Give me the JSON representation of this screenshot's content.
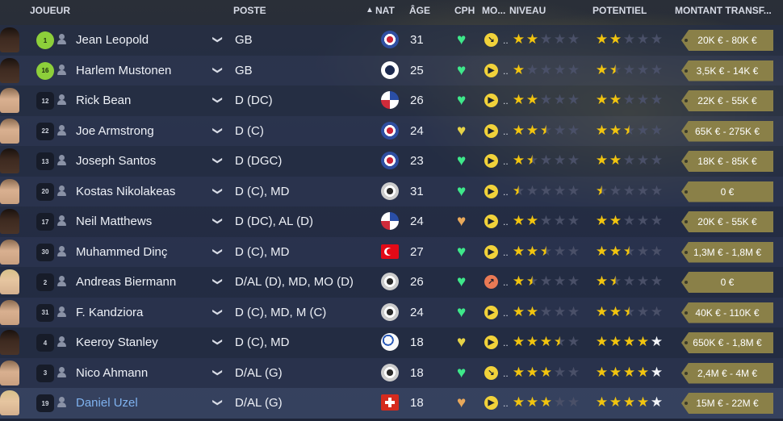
{
  "header": {
    "joueur": "JOUEUR",
    "poste": "POSTE",
    "sort_arrow": "▲",
    "nat": "NAT",
    "age": "ÂGE",
    "cph": "CPH",
    "mo": "MO...",
    "niveau": "NIVEAU",
    "potentiel": "POTENTIEL",
    "montant": "MONTANT TRANSF..."
  },
  "players": [
    {
      "shirt": "1",
      "name": "Jean Leopold",
      "poste": "GB",
      "nat": "fr",
      "age": "31",
      "cph": "g",
      "mor": "down",
      "niveau": 2,
      "potentiel": 2,
      "pot_color": "empty",
      "value": "20K € - 80K €"
    },
    {
      "shirt": "16",
      "name": "Harlem Mustonen",
      "poste": "GB",
      "nat": "gr",
      "age": "25",
      "cph": "g",
      "mor": "right",
      "niveau": 1,
      "potentiel": 1.5,
      "pot_color": "empty",
      "value": "3,5K € - 14K €"
    },
    {
      "shirt": "12",
      "name": "Rick Bean",
      "poste": "D (DC)",
      "nat": "us",
      "age": "26",
      "cph": "g",
      "mor": "right",
      "niveau": 2,
      "potentiel": 2,
      "pot_color": "empty",
      "value": "22K € - 55K €"
    },
    {
      "shirt": "22",
      "name": "Joe Armstrong",
      "poste": "D (C)",
      "nat": "fr",
      "age": "24",
      "cph": "y",
      "mor": "right",
      "niveau": 2.5,
      "potentiel": 2.5,
      "pot_color": "empty",
      "value": "65K € - 275K €"
    },
    {
      "shirt": "13",
      "name": "Joseph Santos",
      "poste": "D (DGC)",
      "nat": "fr",
      "age": "23",
      "cph": "g",
      "mor": "right",
      "niveau": 1.5,
      "potentiel": 2,
      "pot_color": "empty",
      "value": "18K € - 85K €"
    },
    {
      "shirt": "20",
      "name": "Kostas Nikolakeas",
      "poste": "D (C), MD",
      "nat": "de",
      "age": "31",
      "cph": "g",
      "mor": "right",
      "niveau": 0.5,
      "potentiel": 0.5,
      "pot_color": "empty",
      "value": "0 €"
    },
    {
      "shirt": "17",
      "name": "Neil Matthews",
      "poste": "D (DC), AL (D)",
      "nat": "us",
      "age": "24",
      "cph": "o",
      "mor": "right",
      "niveau": 2,
      "potentiel": 2,
      "pot_color": "empty",
      "value": "20K € - 55K €"
    },
    {
      "shirt": "30",
      "name": "Muhammed Dinç",
      "poste": "D (C), MD",
      "nat": "tr",
      "age": "27",
      "cph": "g",
      "mor": "right",
      "niveau": 2.5,
      "potentiel": 2.5,
      "pot_color": "empty",
      "value": "1,3M € - 1,8M €"
    },
    {
      "shirt": "2",
      "name": "Andreas Biermann",
      "poste": "D/AL (D), MD, MO (D)",
      "nat": "de",
      "age": "26",
      "cph": "g",
      "mor": "up",
      "niveau": 1.5,
      "potentiel": 1.5,
      "pot_color": "empty",
      "value": "0 €"
    },
    {
      "shirt": "31",
      "name": "F. Kandziora",
      "poste": "D (C), MD, M (C)",
      "nat": "de",
      "age": "24",
      "cph": "g",
      "mor": "right",
      "niveau": 2,
      "potentiel": 2.5,
      "pot_color": "empty",
      "value": "40K € - 110K €"
    },
    {
      "shirt": "4",
      "name": "Keeroy Stanley",
      "poste": "D (C), MD",
      "nat": "ball",
      "age": "18",
      "cph": "y",
      "mor": "right",
      "niveau": 3.5,
      "potentiel": 4,
      "pot_color": "white",
      "value": "650K € - 1,8M €"
    },
    {
      "shirt": "3",
      "name": "Nico Ahmann",
      "poste": "D/AL (G)",
      "nat": "de",
      "age": "18",
      "cph": "g",
      "mor": "down",
      "niveau": 3,
      "potentiel": 4,
      "pot_color": "white",
      "value": "2,4M € - 4M €"
    },
    {
      "shirt": "19",
      "name": "Daniel Uzel",
      "poste": "D/AL (G)",
      "nat": "ch",
      "age": "18",
      "cph": "o",
      "mor": "right",
      "niveau": 3,
      "potentiel": 4,
      "pot_color": "white",
      "value": "15M € - 22M €"
    }
  ],
  "icons": {
    "chevron": "chevron-down-icon",
    "heart": "heart-icon",
    "person": "person-icon",
    "morale": "morale-icon"
  },
  "colors": {
    "star": "#f1c40f",
    "cph_green": "#3ee88a",
    "cph_yellow": "#e6d247",
    "cph_orange": "#e8a85a",
    "value_tag": "#8a8048",
    "highlight_name": "#7fb2ef"
  }
}
